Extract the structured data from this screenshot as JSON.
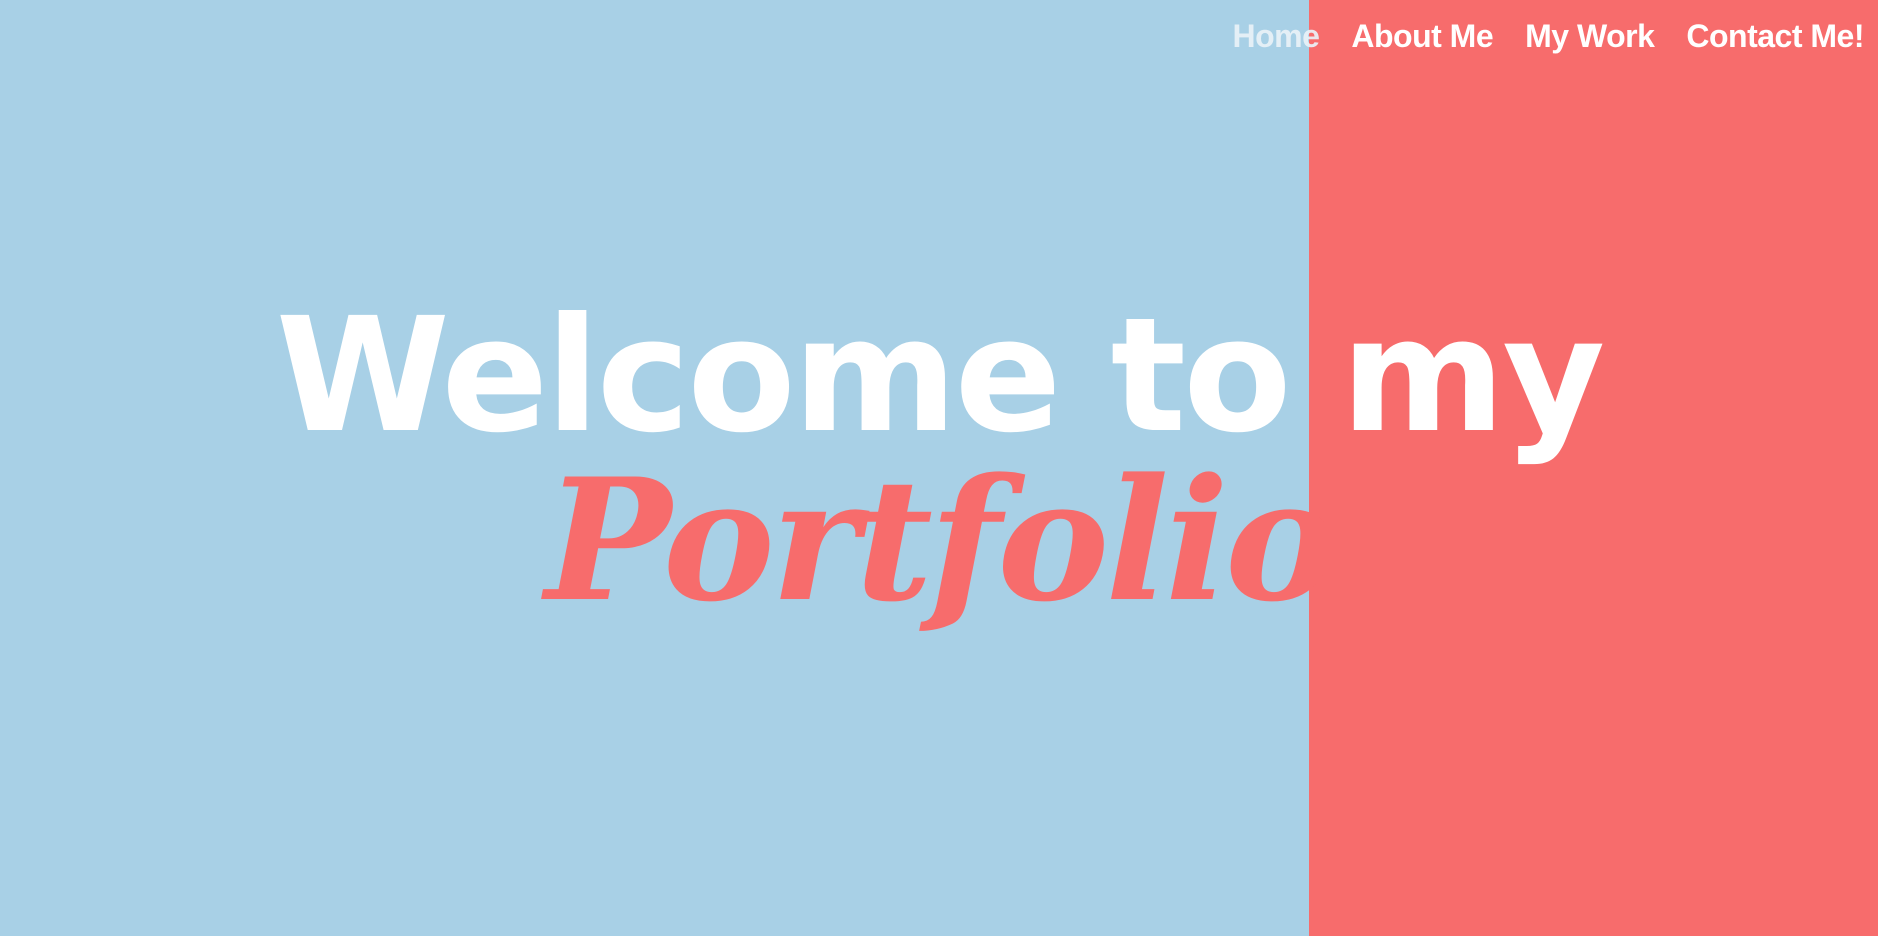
{
  "nav": {
    "items": [
      {
        "label": "Home"
      },
      {
        "label": "About Me"
      },
      {
        "label": "My Work"
      },
      {
        "label": "Contact Me!"
      }
    ]
  },
  "hero": {
    "welcome_text": "Welcome to my",
    "portfolio_text": "Portfolio"
  },
  "colors": {
    "background_blue": "#a8d0e6",
    "accent_coral": "#f76c6c",
    "text_white": "#ffffff"
  }
}
